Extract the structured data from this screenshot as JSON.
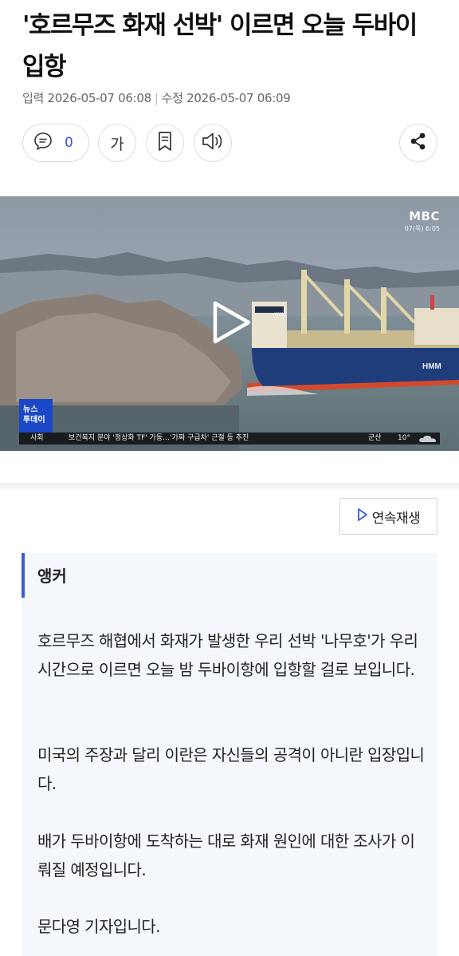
{
  "article": {
    "headline": "'호르무즈 화재 선박' 이르면 오늘 두바이 입항",
    "published_label": "입력",
    "published_at": "2026-05-07 06:08",
    "modified_label": "수정",
    "modified_at": "2026-05-07 06:09"
  },
  "toolbar": {
    "comment_count": "0",
    "font_size_label": "가",
    "icons": {
      "comment": "comment-bubble-icon",
      "bookmark": "bookmark-icon",
      "audio": "speaker-icon",
      "share": "share-icon"
    }
  },
  "video": {
    "broadcaster": "MBC",
    "broadcast_time": "07(목) 6:05",
    "program_badge_line1": "뉴스",
    "program_badge_line2": "투데이",
    "ticker_category": "사회",
    "ticker_text": "보건복지 분야 '정상화 TF' 가동…'가짜 구급차' 근절 등 추진",
    "weather_city": "군산",
    "weather_temp": "10°",
    "ship_logo": "HMM",
    "play_icon": "play-icon"
  },
  "autoplay_label": "연속재생",
  "body": {
    "anchor_label": "앵커",
    "paragraphs": [
      "호르무즈 해협에서 화재가 발생한 우리 선박 '나무호'가 우리 시간으로 이르면 오늘 밤 두바이항에 입항할 걸로 보입니다.",
      "미국의 주장과 달리 이란은 자신들의 공격이 아니란 입장입니다.",
      "배가 두바이항에 도착하는 대로 화재 원인에 대한 조사가 이뤄질 예정입니다.",
      "문다영 기자입니다."
    ]
  },
  "colors": {
    "accent": "#3a5bd9",
    "comment_count": "#3b4fd8",
    "article_bg": "#f4f7fc",
    "badge": "#1b48c8"
  }
}
